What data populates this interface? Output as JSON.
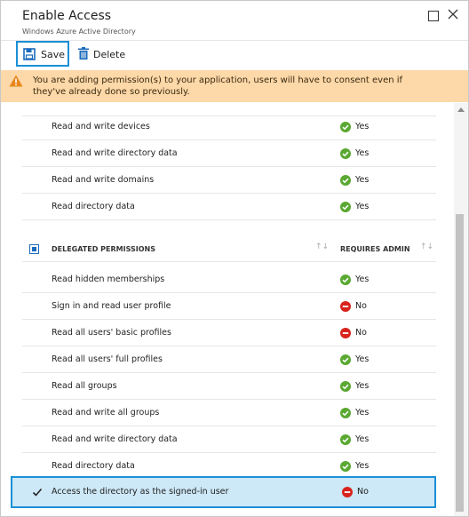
{
  "header": {
    "title": "Enable Access",
    "subtitle": "Windows Azure Active Directory"
  },
  "toolbar": {
    "save_label": "Save",
    "delete_label": "Delete"
  },
  "warning": {
    "text": "You are adding permission(s) to your application, users will have to consent even if they've already done so previously."
  },
  "app_permissions": [
    {
      "label": "Read and write devices",
      "status": "Yes"
    },
    {
      "label": "Read and write directory data",
      "status": "Yes"
    },
    {
      "label": "Read and write domains",
      "status": "Yes"
    },
    {
      "label": "Read directory data",
      "status": "Yes"
    }
  ],
  "delegated": {
    "header_label": "DELEGATED PERMISSIONS",
    "admin_header": "REQUIRES ADMIN",
    "rows": [
      {
        "label": "Read hidden memberships",
        "status": "Yes"
      },
      {
        "label": "Sign in and read user profile",
        "status": "No"
      },
      {
        "label": "Read all users' basic profiles",
        "status": "No"
      },
      {
        "label": "Read all users' full profiles",
        "status": "Yes"
      },
      {
        "label": "Read all groups",
        "status": "Yes"
      },
      {
        "label": "Read and write all groups",
        "status": "Yes"
      },
      {
        "label": "Read and write directory data",
        "status": "Yes"
      },
      {
        "label": "Read directory data",
        "status": "Yes"
      }
    ],
    "selected": {
      "label": "Access the directory as the signed-in user",
      "status": "No"
    }
  },
  "colors": {
    "accent": "#1b8fd6",
    "yes": "#5aa832",
    "no": "#d8231c",
    "warning_bg": "#fdd8a8",
    "selected_bg": "#cde8f7"
  }
}
